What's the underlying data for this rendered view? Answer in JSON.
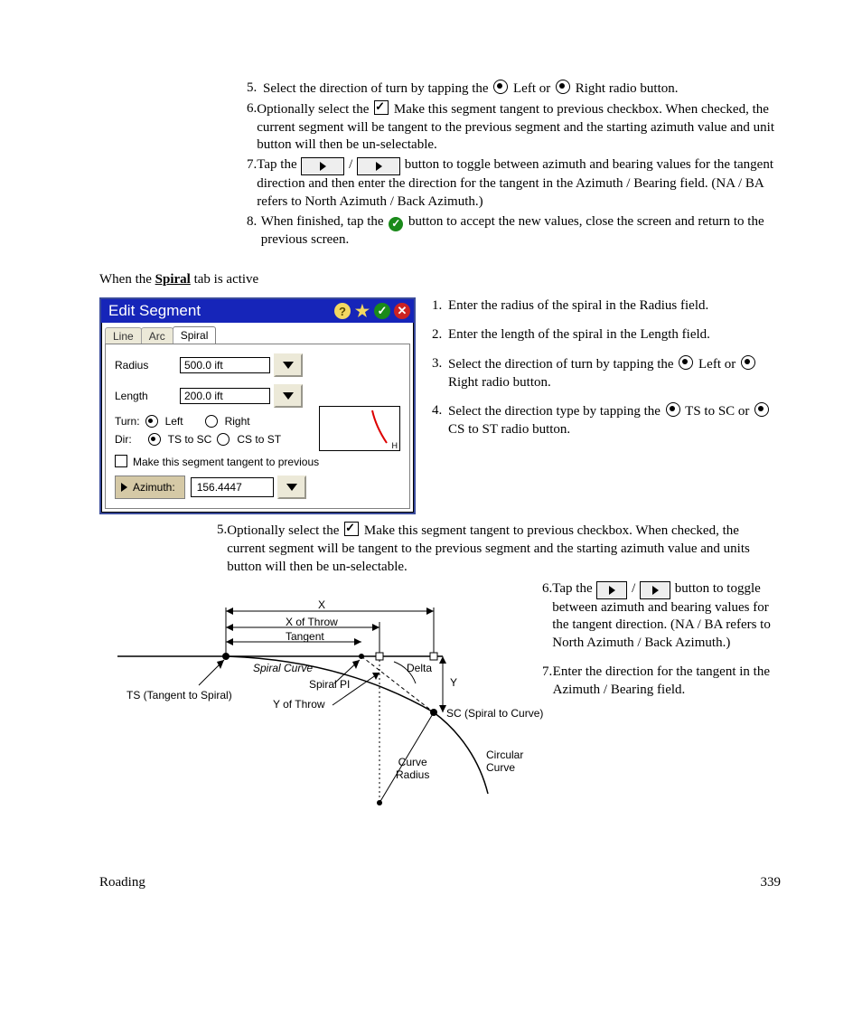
{
  "bullets_top": [
    {
      "n": "5.",
      "pre": "Select the direction of turn by tapping the ",
      "radio_after": " Left or ",
      "radio_after2": " Right radio button."
    },
    {
      "n": "6.",
      "pre": "Optionally select the ",
      "check_after": " Make this segment tangent to previous checkbox. When checked, the current segment will be tangent to the previous segment and the starting azimuth value and unit button will then be un-selectable."
    },
    {
      "n": "7.",
      "pre": "Tap the ",
      "btn_gap": " button to toggle between azimuth and bearing values for the tangent direction and then enter the direction for the tangent in the Azimuth / Bearing field. (NA / BA refers to North Azimuth / Back Azimuth.)"
    },
    {
      "n": "8.",
      "pre": "When finished, tap the ",
      "ok_after": " button to accept the new values, close the screen and return to the previous screen."
    }
  ],
  "spiral_heading_pre": "When the ",
  "spiral_heading_bold": "Spiral",
  "spiral_heading_post": " tab is active",
  "dialog": {
    "title": "Edit Segment",
    "tabs": [
      "Line",
      "Arc",
      "Spiral"
    ],
    "radius_label": "Radius",
    "radius_value": "500.0 ift",
    "length_label": "Length",
    "length_value": "200.0 ift",
    "turn_label": "Turn:",
    "turn_left": "Left",
    "turn_right": "Right",
    "dir_label": "Dir:",
    "dir_ts": "TS to SC",
    "dir_cs": "CS to ST",
    "plot_label": "H",
    "tangent_label": "Make this segment tangent to previous",
    "azimuth_btn": "Azimuth:",
    "azimuth_value": "156.4447"
  },
  "bullets_right": [
    {
      "n": "1.",
      "text": "Enter the radius of the spiral in the Radius field."
    },
    {
      "n": "2.",
      "text": "Enter the length of the spiral in the Length field."
    },
    {
      "n": "3.",
      "pre": "Select the direction of turn by tapping the ",
      "left": " Left or ",
      "right": " Right radio button."
    },
    {
      "n": "4.",
      "pre": "Select the direction type by tapping the ",
      "ts": " TS to SC or ",
      "cs": " CS to ST radio button."
    },
    {
      "n": "5.",
      "pre": "Optionally select the ",
      "rest": " Make this segment tangent to previous checkbox. When checked, the current segment will be tangent to the previous segment and the starting azimuth value and units button will then be un-selectable."
    },
    {
      "n": "6.",
      "pre": "Tap the ",
      "rest": " button to toggle between azimuth and bearing values for the tangent direction. (NA / BA refers to North Azimuth / Back Azimuth.)"
    },
    {
      "n": "7.",
      "text": "Enter the direction for the tangent in the Azimuth / Bearing field."
    }
  ],
  "diag": {
    "x": "X",
    "xthrow": "X of Throw",
    "tangent": "Tangent",
    "delta": "Delta",
    "y": "Y",
    "spiralcurve": "Spiral Curve",
    "spiralpi": "Spiral PI",
    "ts": "TS (Tangent to Spiral)",
    "ythrow": "Y of Throw",
    "curverad": "Curve\nRadius",
    "circ": "Circular\nCurve",
    "sc": "SC (Spiral to Curve)"
  },
  "footer_left": "Roading",
  "footer_right": "339"
}
